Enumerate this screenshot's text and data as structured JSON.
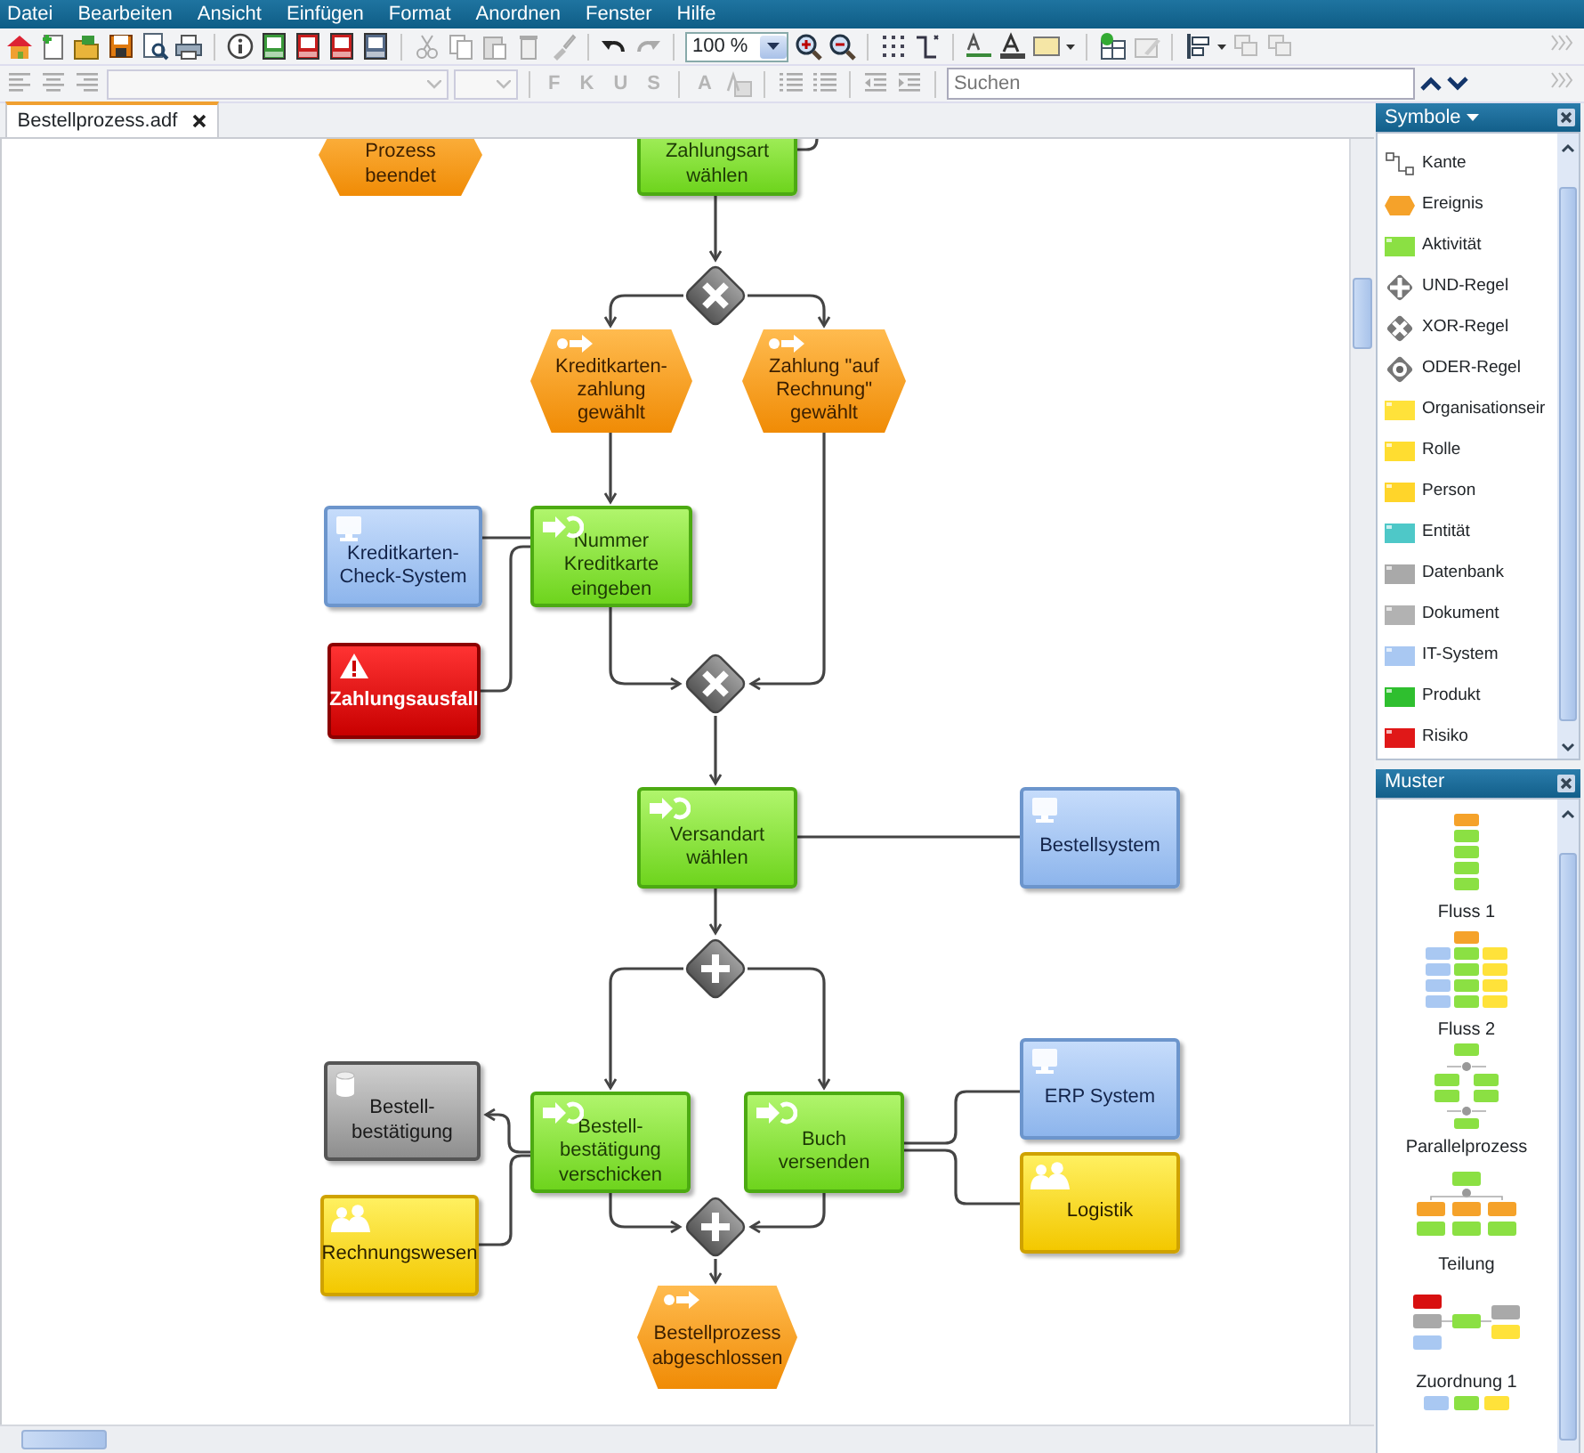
{
  "menu_bar": [
    "Datei",
    "Bearbeiten",
    "Ansicht",
    "Einfügen",
    "Format",
    "Anordnen",
    "Fenster",
    "Hilfe"
  ],
  "toolbar": {
    "zoom": "100 %"
  },
  "format_toolbar": {
    "buttons": [
      {
        "label": "F",
        "disabled": true
      },
      {
        "label": "K",
        "disabled": true
      },
      {
        "label": "U",
        "disabled": true
      },
      {
        "label": "S",
        "disabled": true
      },
      {
        "label": "A",
        "disabled": true
      }
    ],
    "search": {
      "placeholder": "Suchen"
    }
  },
  "tabs": [
    {
      "label": "Bestellprozess.adf",
      "selected": true
    }
  ],
  "diagram": {
    "nodes": [
      {
        "kind": "event",
        "label": "Prozess beendet"
      },
      {
        "kind": "function",
        "label": "Zahlungsart wählen"
      },
      {
        "kind": "event",
        "label": "Kreditkarten-zahlung gewählt"
      },
      {
        "kind": "event",
        "label": "Zahlung \"auf Rechnung\" gewählt"
      },
      {
        "kind": "it_system",
        "label": "Kreditkarten-Check-System"
      },
      {
        "kind": "function",
        "label": "Nummer Kreditkarte eingeben"
      },
      {
        "kind": "risk",
        "label": "Zahlungsausfall"
      },
      {
        "kind": "function",
        "label": "Versandart wählen"
      },
      {
        "kind": "it_system",
        "label": "Bestellsystem"
      },
      {
        "kind": "document",
        "label": "Bestell-bestätigung"
      },
      {
        "kind": "function",
        "label": "Bestell-bestätigung verschicken"
      },
      {
        "kind": "function",
        "label": "Buch versenden"
      },
      {
        "kind": "it_system",
        "label": "ERP System"
      },
      {
        "kind": "org",
        "label": "Logistik"
      },
      {
        "kind": "org",
        "label": "Rechnungswesen"
      },
      {
        "kind": "event",
        "label": "Bestellprozess abgeschlossen"
      }
    ],
    "gateways": [
      {
        "kind": "xor"
      },
      {
        "kind": "xor"
      },
      {
        "kind": "and"
      },
      {
        "kind": "and"
      }
    ]
  },
  "symbols_panel": {
    "title": "Symbole",
    "items": [
      {
        "kind": "edge",
        "label": "Kante"
      },
      {
        "kind": "event",
        "label": "Ereignis"
      },
      {
        "kind": "function",
        "label": "Aktivität"
      },
      {
        "kind": "and",
        "label": "UND-Regel"
      },
      {
        "kind": "xor",
        "label": "XOR-Regel"
      },
      {
        "kind": "or",
        "label": "ODER-Regel"
      },
      {
        "kind": "org",
        "label": "Organisationseir"
      },
      {
        "kind": "role",
        "label": "Rolle"
      },
      {
        "kind": "person",
        "label": "Person"
      },
      {
        "kind": "entity",
        "label": "Entität"
      },
      {
        "kind": "database",
        "label": "Datenbank"
      },
      {
        "kind": "document",
        "label": "Dokument"
      },
      {
        "kind": "it_system",
        "label": "IT-System"
      },
      {
        "kind": "product",
        "label": "Produkt"
      },
      {
        "kind": "risk",
        "label": "Risiko"
      }
    ]
  },
  "patterns_panel": {
    "title": "Muster",
    "items": [
      {
        "label": "Fluss 1"
      },
      {
        "label": "Fluss 2"
      },
      {
        "label": "Parallelprozess"
      },
      {
        "label": "Teilung"
      },
      {
        "label": "Zuordnung 1"
      }
    ]
  }
}
